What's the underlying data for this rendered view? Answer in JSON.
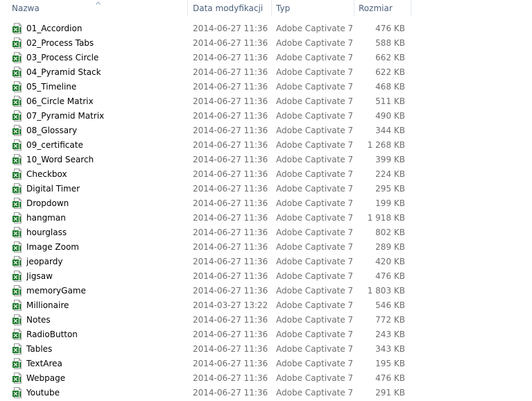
{
  "columns": {
    "name": "Nazwa",
    "date": "Data modyfikacji",
    "type": "Typ",
    "size": "Rozmiar"
  },
  "colors": {
    "header_text": "#4c607a",
    "meta_text": "#6d6d6d",
    "icon_green": "#1f7a2e"
  },
  "files": [
    {
      "name": "01_Accordion",
      "date": "2014-06-27 11:36",
      "type": "Adobe Captivate 7...",
      "size": "476 KB"
    },
    {
      "name": "02_Process Tabs",
      "date": "2014-06-27 11:36",
      "type": "Adobe Captivate 7...",
      "size": "588 KB"
    },
    {
      "name": "03_Process Circle",
      "date": "2014-06-27 11:36",
      "type": "Adobe Captivate 7...",
      "size": "662 KB"
    },
    {
      "name": "04_Pyramid Stack",
      "date": "2014-06-27 11:36",
      "type": "Adobe Captivate 7...",
      "size": "622 KB"
    },
    {
      "name": "05_Timeline",
      "date": "2014-06-27 11:36",
      "type": "Adobe Captivate 7...",
      "size": "468 KB"
    },
    {
      "name": "06_Circle Matrix",
      "date": "2014-06-27 11:36",
      "type": "Adobe Captivate 7...",
      "size": "511 KB"
    },
    {
      "name": "07_Pyramid Matrix",
      "date": "2014-06-27 11:36",
      "type": "Adobe Captivate 7...",
      "size": "490 KB"
    },
    {
      "name": "08_Glossary",
      "date": "2014-06-27 11:36",
      "type": "Adobe Captivate 7...",
      "size": "344 KB"
    },
    {
      "name": "09_certificate",
      "date": "2014-06-27 11:36",
      "type": "Adobe Captivate 7...",
      "size": "1 268 KB"
    },
    {
      "name": "10_Word Search",
      "date": "2014-06-27 11:36",
      "type": "Adobe Captivate 7...",
      "size": "399 KB"
    },
    {
      "name": "Checkbox",
      "date": "2014-06-27 11:36",
      "type": "Adobe Captivate 7...",
      "size": "224 KB"
    },
    {
      "name": "Digital Timer",
      "date": "2014-06-27 11:36",
      "type": "Adobe Captivate 7...",
      "size": "295 KB"
    },
    {
      "name": "Dropdown",
      "date": "2014-06-27 11:36",
      "type": "Adobe Captivate 7...",
      "size": "199 KB"
    },
    {
      "name": "hangman",
      "date": "2014-06-27 11:36",
      "type": "Adobe Captivate 7...",
      "size": "1 918 KB"
    },
    {
      "name": "hourglass",
      "date": "2014-06-27 11:36",
      "type": "Adobe Captivate 7...",
      "size": "802 KB"
    },
    {
      "name": "Image Zoom",
      "date": "2014-06-27 11:36",
      "type": "Adobe Captivate 7...",
      "size": "289 KB"
    },
    {
      "name": "jeopardy",
      "date": "2014-06-27 11:36",
      "type": "Adobe Captivate 7...",
      "size": "420 KB"
    },
    {
      "name": "Jigsaw",
      "date": "2014-06-27 11:36",
      "type": "Adobe Captivate 7...",
      "size": "476 KB"
    },
    {
      "name": "memoryGame",
      "date": "2014-06-27 11:36",
      "type": "Adobe Captivate 7...",
      "size": "1 803 KB"
    },
    {
      "name": "Millionaire",
      "date": "2014-03-27 13:22",
      "type": "Adobe Captivate 7...",
      "size": "546 KB"
    },
    {
      "name": "Notes",
      "date": "2014-06-27 11:36",
      "type": "Adobe Captivate 7...",
      "size": "772 KB"
    },
    {
      "name": "RadioButton",
      "date": "2014-06-27 11:36",
      "type": "Adobe Captivate 7...",
      "size": "243 KB"
    },
    {
      "name": "Tables",
      "date": "2014-06-27 11:36",
      "type": "Adobe Captivate 7...",
      "size": "343 KB"
    },
    {
      "name": "TextArea",
      "date": "2014-06-27 11:36",
      "type": "Adobe Captivate 7...",
      "size": "195 KB"
    },
    {
      "name": "Webpage",
      "date": "2014-06-27 11:36",
      "type": "Adobe Captivate 7...",
      "size": "476 KB"
    },
    {
      "name": "Youtube",
      "date": "2014-06-27 11:36",
      "type": "Adobe Captivate 7...",
      "size": "291 KB"
    }
  ]
}
